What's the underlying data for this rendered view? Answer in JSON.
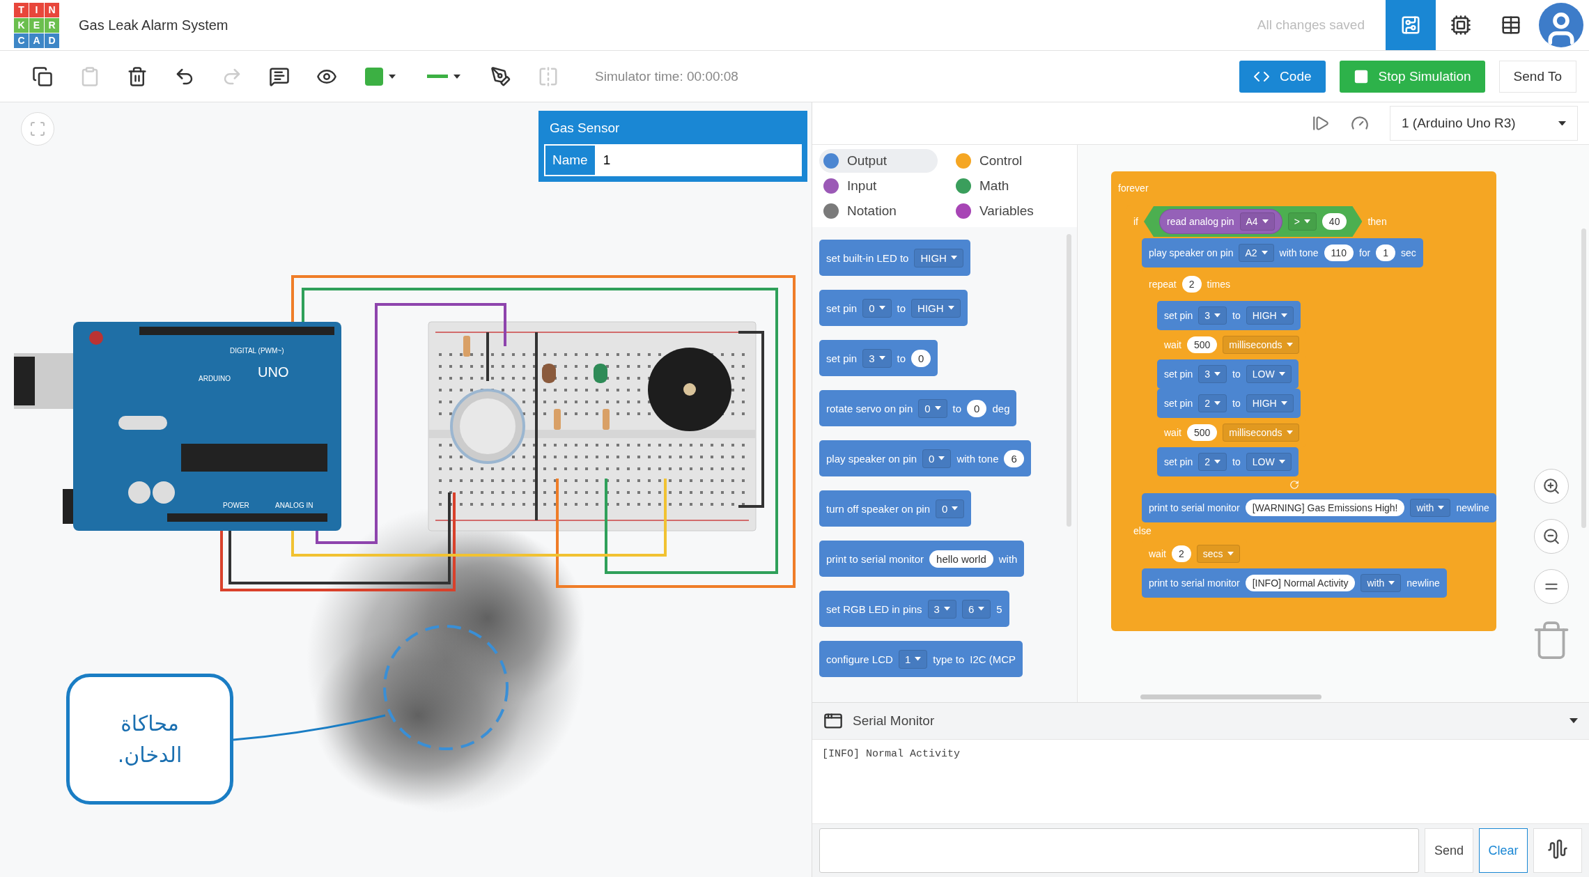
{
  "topbar": {
    "logo": [
      [
        "T",
        "I",
        "N"
      ],
      [
        "K",
        "E",
        "R"
      ],
      [
        "C",
        "A",
        "D"
      ]
    ],
    "title": "Gas Leak Alarm System",
    "save_status": "All changes saved",
    "views": [
      {
        "kind": "circuit",
        "selected": true
      },
      {
        "kind": "schematic",
        "selected": false
      },
      {
        "kind": "components",
        "selected": false
      }
    ]
  },
  "toolbar": {
    "tools": [
      {
        "kind": "copy",
        "disabled": false
      },
      {
        "kind": "paste",
        "disabled": true
      },
      {
        "kind": "delete",
        "disabled": false
      },
      {
        "kind": "undo",
        "disabled": false
      },
      {
        "kind": "redo",
        "disabled": true
      },
      {
        "kind": "note",
        "disabled": false
      },
      {
        "kind": "notes-toggle",
        "disabled": false
      },
      {
        "kind": "color",
        "disabled": false,
        "color": "#3cb043"
      },
      {
        "kind": "wire-style",
        "disabled": false
      },
      {
        "kind": "pen",
        "disabled": false
      },
      {
        "kind": "mirror",
        "disabled": true
      }
    ],
    "sim_time": "Simulator time: 00:00:08",
    "code_button": "Code",
    "stop_button": "Stop Simulation",
    "send_button": "Send To"
  },
  "inspector": {
    "title": "Gas Sensor",
    "field_label": "Name",
    "field_value": "1"
  },
  "circuit": {
    "board_labels": [
      "DIGITAL (PWM~)",
      "ARDUINO",
      "UNO",
      "POWER",
      "ANALOG IN"
    ]
  },
  "callout": {
    "text": "محاكاة الدخان."
  },
  "code_panel": {
    "board_select": "1 (Arduino Uno R3)",
    "categories": [
      {
        "label": "Output",
        "color": "#4c86d1",
        "selected": true
      },
      {
        "label": "Control",
        "color": "#f5a623",
        "selected": false
      },
      {
        "label": "Input",
        "color": "#9b59b6",
        "selected": false
      },
      {
        "label": "Math",
        "color": "#3a9e5c",
        "selected": false
      },
      {
        "label": "Notation",
        "color": "#7a7a7a",
        "selected": false
      },
      {
        "label": "Variables",
        "color": "#a745b5",
        "selected": false
      }
    ],
    "palette": [
      {
        "parts": [
          {
            "kind": "label",
            "text": "set built-in LED to"
          },
          {
            "kind": "dropdown",
            "text": "HIGH"
          }
        ]
      },
      {
        "parts": [
          {
            "kind": "label",
            "text": "set pin"
          },
          {
            "kind": "dropdown",
            "text": "0"
          },
          {
            "kind": "label",
            "text": "to"
          },
          {
            "kind": "dropdown",
            "text": "HIGH"
          }
        ]
      },
      {
        "parts": [
          {
            "kind": "label",
            "text": "set pin"
          },
          {
            "kind": "dropdown",
            "text": "3"
          },
          {
            "kind": "label",
            "text": "to"
          },
          {
            "kind": "number",
            "text": "0"
          }
        ]
      },
      {
        "parts": [
          {
            "kind": "label",
            "text": "rotate servo on pin"
          },
          {
            "kind": "dropdown",
            "text": "0"
          },
          {
            "kind": "label",
            "text": "to"
          },
          {
            "kind": "number",
            "text": "0"
          },
          {
            "kind": "label",
            "text": "deg"
          }
        ]
      },
      {
        "parts": [
          {
            "kind": "label",
            "text": "play speaker on pin"
          },
          {
            "kind": "dropdown",
            "text": "0"
          },
          {
            "kind": "label",
            "text": "with tone"
          },
          {
            "kind": "number",
            "text": "6"
          }
        ]
      },
      {
        "parts": [
          {
            "kind": "label",
            "text": "turn off speaker on pin"
          },
          {
            "kind": "dropdown",
            "text": "0"
          }
        ]
      },
      {
        "parts": [
          {
            "kind": "label",
            "text": "print to serial monitor"
          },
          {
            "kind": "string",
            "text": "hello world"
          },
          {
            "kind": "label",
            "text": "with"
          }
        ]
      },
      {
        "parts": [
          {
            "kind": "label",
            "text": "set RGB LED in pins"
          },
          {
            "kind": "dropdown",
            "text": "3"
          },
          {
            "kind": "dropdown",
            "text": "6"
          },
          {
            "kind": "label",
            "text": "5"
          }
        ]
      },
      {
        "parts": [
          {
            "kind": "label",
            "text": "configure LCD"
          },
          {
            "kind": "dropdown",
            "text": "1"
          },
          {
            "kind": "label",
            "text": "type to"
          },
          {
            "kind": "label",
            "text": "I2C (MCP"
          }
        ]
      }
    ],
    "program": {
      "kind": "loop",
      "color": "#f5a623",
      "parts": [
        {
          "kind": "label",
          "text": "forever"
        }
      ],
      "body": [
        {
          "kind": "ifelse",
          "color": "#f5a623",
          "parts": [
            {
              "kind": "label",
              "text": "if"
            },
            {
              "kind": "boolean",
              "color": "#4caf50",
              "parts": [
                {
                  "kind": "reporter",
                  "color": "#9561b8",
                  "parts": [
                    {
                      "kind": "label",
                      "text": "read analog pin"
                    },
                    {
                      "kind": "dropdown",
                      "text": "A4"
                    }
                  ]
                },
                {
                  "kind": "dropdown",
                  "text": ">"
                },
                {
                  "kind": "number",
                  "text": "40"
                }
              ]
            },
            {
              "kind": "label",
              "text": "then"
            }
          ],
          "body": [
            {
              "kind": "statement",
              "color": "#4c86d1",
              "parts": [
                {
                  "kind": "label",
                  "text": "play speaker on pin"
                },
                {
                  "kind": "dropdown",
                  "text": "A2"
                },
                {
                  "kind": "label",
                  "text": "with tone"
                },
                {
                  "kind": "number",
                  "text": "110"
                },
                {
                  "kind": "label",
                  "text": "for"
                },
                {
                  "kind": "number",
                  "text": "1"
                },
                {
                  "kind": "label",
                  "text": "sec"
                }
              ]
            },
            {
              "kind": "repeat",
              "color": "#f5a623",
              "parts": [
                {
                  "kind": "label",
                  "text": "repeat"
                },
                {
                  "kind": "number",
                  "text": "2"
                },
                {
                  "kind": "label",
                  "text": "times"
                }
              ],
              "body": [
                {
                  "kind": "statement",
                  "color": "#4c86d1",
                  "parts": [
                    {
                      "kind": "label",
                      "text": "set pin"
                    },
                    {
                      "kind": "dropdown",
                      "text": "3"
                    },
                    {
                      "kind": "label",
                      "text": "to"
                    },
                    {
                      "kind": "dropdown",
                      "text": "HIGH"
                    }
                  ]
                },
                {
                  "kind": "statement",
                  "color": "#f5a623",
                  "parts": [
                    {
                      "kind": "label",
                      "text": "wait"
                    },
                    {
                      "kind": "number",
                      "text": "500"
                    },
                    {
                      "kind": "dropdown",
                      "text": "milliseconds"
                    }
                  ]
                },
                {
                  "kind": "statement",
                  "color": "#4c86d1",
                  "parts": [
                    {
                      "kind": "label",
                      "text": "set pin"
                    },
                    {
                      "kind": "dropdown",
                      "text": "3"
                    },
                    {
                      "kind": "label",
                      "text": "to"
                    },
                    {
                      "kind": "dropdown",
                      "text": "LOW"
                    }
                  ]
                },
                {
                  "kind": "statement",
                  "color": "#4c86d1",
                  "parts": [
                    {
                      "kind": "label",
                      "text": "set pin"
                    },
                    {
                      "kind": "dropdown",
                      "text": "2"
                    },
                    {
                      "kind": "label",
                      "text": "to"
                    },
                    {
                      "kind": "dropdown",
                      "text": "HIGH"
                    }
                  ]
                },
                {
                  "kind": "statement",
                  "color": "#f5a623",
                  "parts": [
                    {
                      "kind": "label",
                      "text": "wait"
                    },
                    {
                      "kind": "number",
                      "text": "500"
                    },
                    {
                      "kind": "dropdown",
                      "text": "milliseconds"
                    }
                  ]
                },
                {
                  "kind": "statement",
                  "color": "#4c86d1",
                  "parts": [
                    {
                      "kind": "label",
                      "text": "set pin"
                    },
                    {
                      "kind": "dropdown",
                      "text": "2"
                    },
                    {
                      "kind": "label",
                      "text": "to"
                    },
                    {
                      "kind": "dropdown",
                      "text": "LOW"
                    }
                  ]
                }
              ]
            },
            {
              "kind": "statement",
              "color": "#4c86d1",
              "parts": [
                {
                  "kind": "label",
                  "text": "print to serial monitor"
                },
                {
                  "kind": "string",
                  "text": "[WARNING] Gas Emissions High!"
                },
                {
                  "kind": "dropdown",
                  "text": "with"
                },
                {
                  "kind": "label",
                  "text": "newline"
                }
              ]
            }
          ],
          "else_label": "else",
          "else_body": [
            {
              "kind": "statement",
              "color": "#f5a623",
              "parts": [
                {
                  "kind": "label",
                  "text": "wait"
                },
                {
                  "kind": "number",
                  "text": "2"
                },
                {
                  "kind": "dropdown",
                  "text": "secs"
                }
              ]
            },
            {
              "kind": "statement",
              "color": "#4c86d1",
              "parts": [
                {
                  "kind": "label",
                  "text": "print to serial monitor"
                },
                {
                  "kind": "string",
                  "text": "[INFO] Normal Activity"
                },
                {
                  "kind": "dropdown",
                  "text": "with"
                },
                {
                  "kind": "label",
                  "text": "newline"
                }
              ]
            }
          ]
        }
      ]
    },
    "serial": {
      "title": "Serial Monitor",
      "output": "[INFO] Normal Activity",
      "send_button": "Send",
      "clear_button": "Clear"
    }
  }
}
